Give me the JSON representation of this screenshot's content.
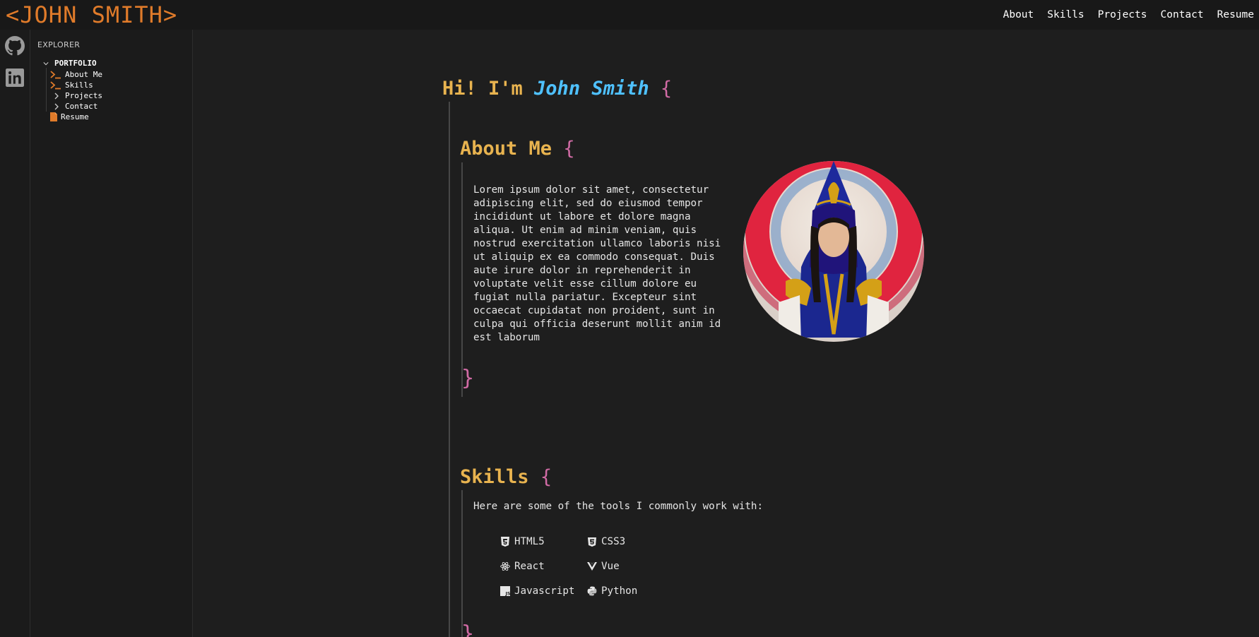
{
  "header": {
    "logo": "<JOHN SMITH>",
    "nav": [
      "About",
      "Skills",
      "Projects",
      "Contact",
      "Resume"
    ]
  },
  "activity_bar": {
    "icons": [
      "github-icon",
      "linkedin-icon"
    ]
  },
  "explorer": {
    "title": "EXPLORER",
    "root": "PORTFOLIO",
    "items": [
      {
        "label": "About Me",
        "icon": "terminal-icon"
      },
      {
        "label": "Skills",
        "icon": "terminal-icon"
      },
      {
        "label": "Projects",
        "icon": "chevron-right-icon"
      },
      {
        "label": "Contact",
        "icon": "chevron-right-icon"
      },
      {
        "label": "Resume",
        "icon": "file-icon"
      }
    ]
  },
  "hero": {
    "prefix": "Hi! I'm ",
    "name": "John Smith",
    "brace_open": "{"
  },
  "about": {
    "title": "About Me",
    "brace_open": "{",
    "brace_close": "}",
    "text": "Lorem ipsum dolor sit amet, consectetur adipiscing elit, sed do eiusmod tempor incididunt ut labore et dolore magna aliqua. Ut enim ad minim veniam, quis nostrud exercitation ullamco laboris nisi ut aliquip ex ea commodo consequat. Duis aute irure dolor in reprehenderit in voluptate velit esse cillum dolore eu fugiat nulla pariatur. Excepteur sint occaecat cupidatat non proident, sunt in culpa qui officia deserunt mollit anim id est laborum"
  },
  "skills": {
    "title": "Skills",
    "brace_open": "{",
    "brace_close": "}",
    "intro": "Here are some of the tools I commonly work with:",
    "items": [
      {
        "label": "HTML5",
        "icon": "html5-icon"
      },
      {
        "label": "CSS3",
        "icon": "css3-icon"
      },
      {
        "label": "React",
        "icon": "react-icon"
      },
      {
        "label": "Vue",
        "icon": "vue-icon"
      },
      {
        "label": "Javascript",
        "icon": "javascript-icon"
      },
      {
        "label": "Python",
        "icon": "python-icon"
      }
    ]
  },
  "colors": {
    "accent": "#e07b2a",
    "heading": "#e8b34f",
    "name": "#4fc1ff",
    "brace": "#d16ba5",
    "background": "#1e1e1e"
  }
}
